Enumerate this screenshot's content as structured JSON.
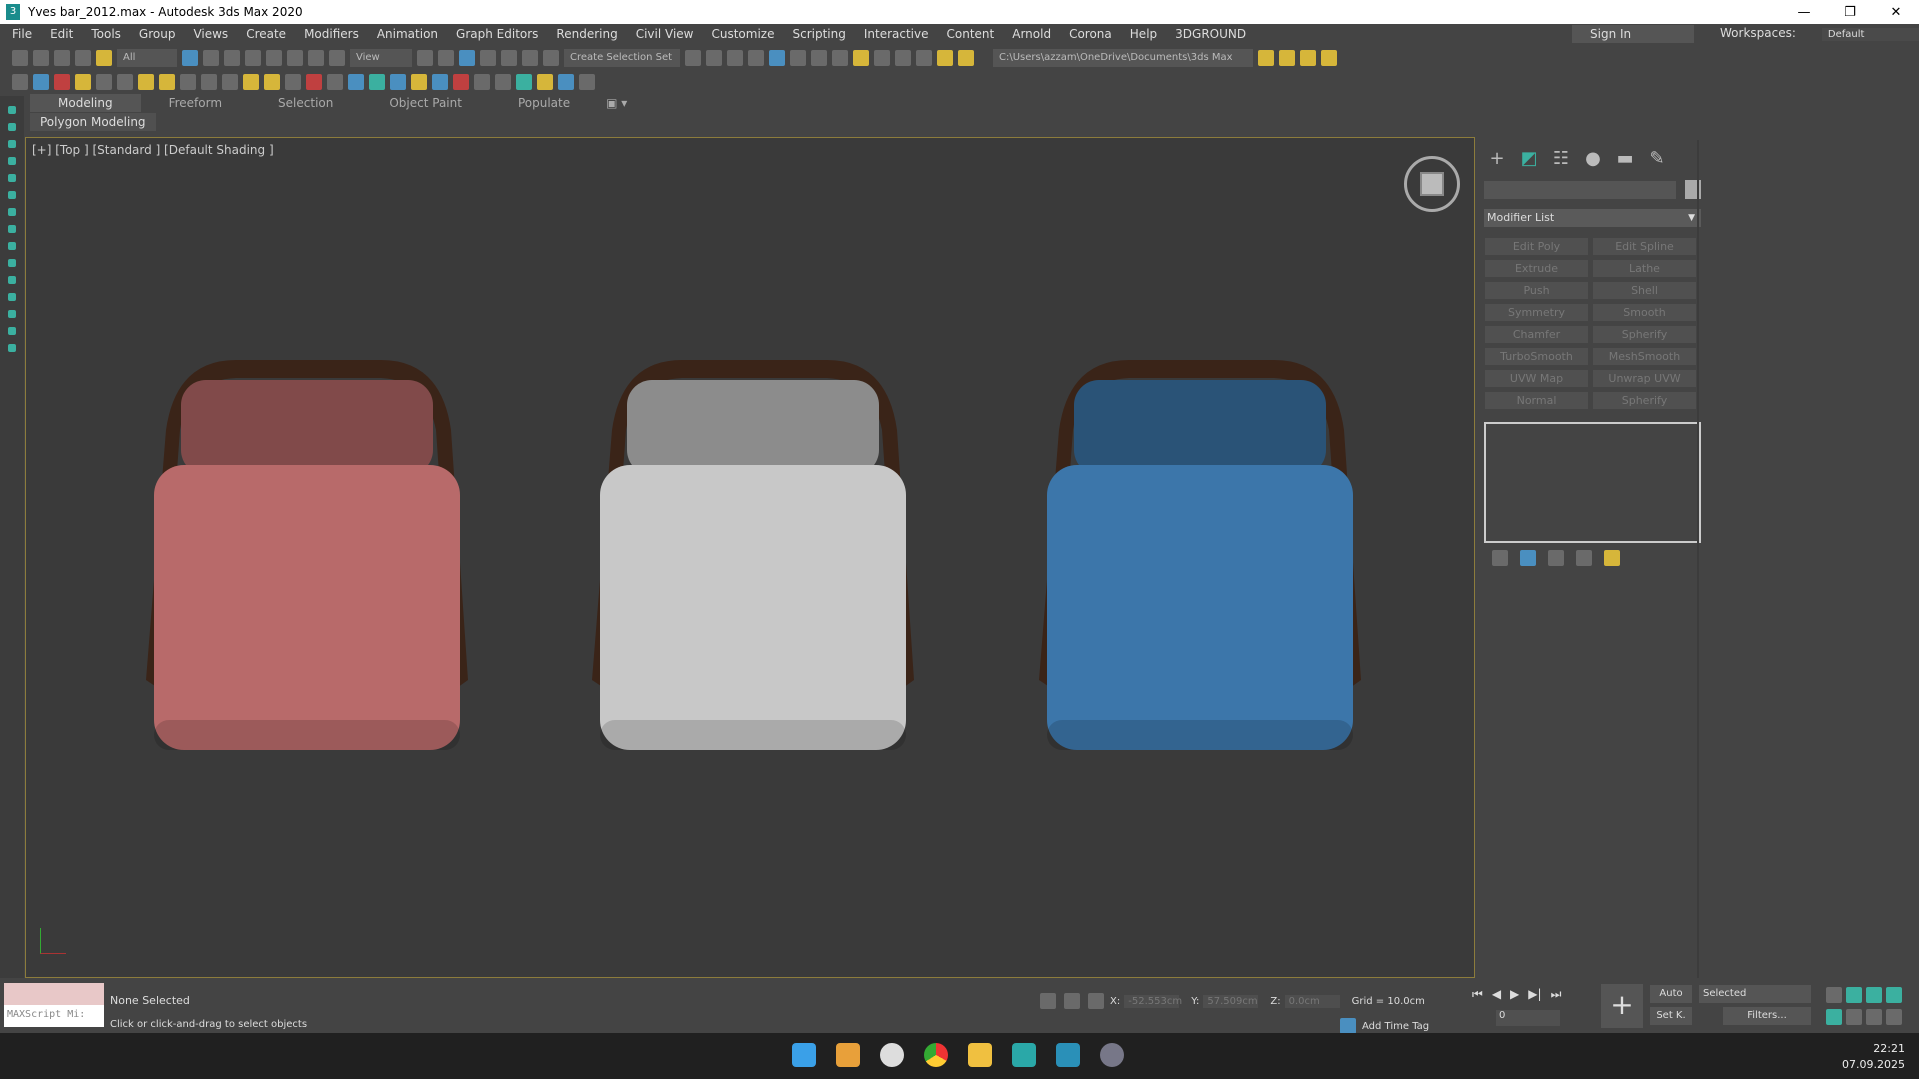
{
  "window": {
    "title": "Yves bar_2012.max - Autodesk 3ds Max 2020",
    "logo": "3",
    "controls": [
      "—",
      "❐",
      "✕"
    ]
  },
  "menu": [
    "File",
    "Edit",
    "Tools",
    "Group",
    "Views",
    "Create",
    "Modifiers",
    "Animation",
    "Graph Editors",
    "Rendering",
    "Civil View",
    "Customize",
    "Scripting",
    "Interactive",
    "Content",
    "Arnold",
    "Corona",
    "Help",
    "3DGROUND"
  ],
  "account": {
    "sign_in": "Sign In",
    "workspaces_label": "Workspaces:",
    "workspace": "Default"
  },
  "toolbar": {
    "selection_filter": "All",
    "reference_coord": "View",
    "named_selection": "Create Selection Set",
    "project_path": "C:\\Users\\azzam\\OneDrive\\Documents\\3ds Max 2020"
  },
  "ribbon": {
    "tabs": [
      "Modeling",
      "Freeform",
      "Selection",
      "Object Paint",
      "Populate"
    ],
    "active": "Modeling",
    "panel": "Polygon Modeling"
  },
  "viewport": {
    "label": "[+] [Top ] [Standard ] [Default Shading ]",
    "chairs": [
      {
        "name": "red-chair",
        "color": "#b86a6a"
      },
      {
        "name": "white-chair",
        "color": "#c8c8c8"
      },
      {
        "name": "blue-chair",
        "color": "#3c76aa"
      }
    ],
    "frame_color": "#3a2418"
  },
  "command_panel": {
    "tabs": [
      "create-icon",
      "modify-icon",
      "hierarchy-icon",
      "motion-icon",
      "display-icon",
      "utilities-icon"
    ],
    "modifier_list": "Modifier List",
    "modifiers": [
      "Edit Poly",
      "Edit Spline",
      "Extrude",
      "Lathe",
      "Push",
      "Shell",
      "Symmetry",
      "Smooth",
      "Chamfer",
      "Spherify",
      "TurboSmooth",
      "MeshSmooth",
      "UVW Map",
      "Unwrap UVW",
      "Normal",
      "Spherify"
    ]
  },
  "status": {
    "selection": "None Selected",
    "prompt": "Click or click-and-drag to select objects",
    "maxscript": "MAXScript Mi:",
    "x_label": "X:",
    "x": "-52.553cm",
    "y_label": "Y:",
    "y": "57.509cm",
    "z_label": "Z:",
    "z": "0.0cm",
    "grid": "Grid = 10.0cm",
    "add_time_tag": "Add Time Tag",
    "frame": "0",
    "auto": "Auto",
    "set_key": "Set K.",
    "key_filter": "Selected",
    "filters": "Filters..."
  },
  "taskbar": {
    "time": "22:21",
    "date": "07.09.2025"
  }
}
